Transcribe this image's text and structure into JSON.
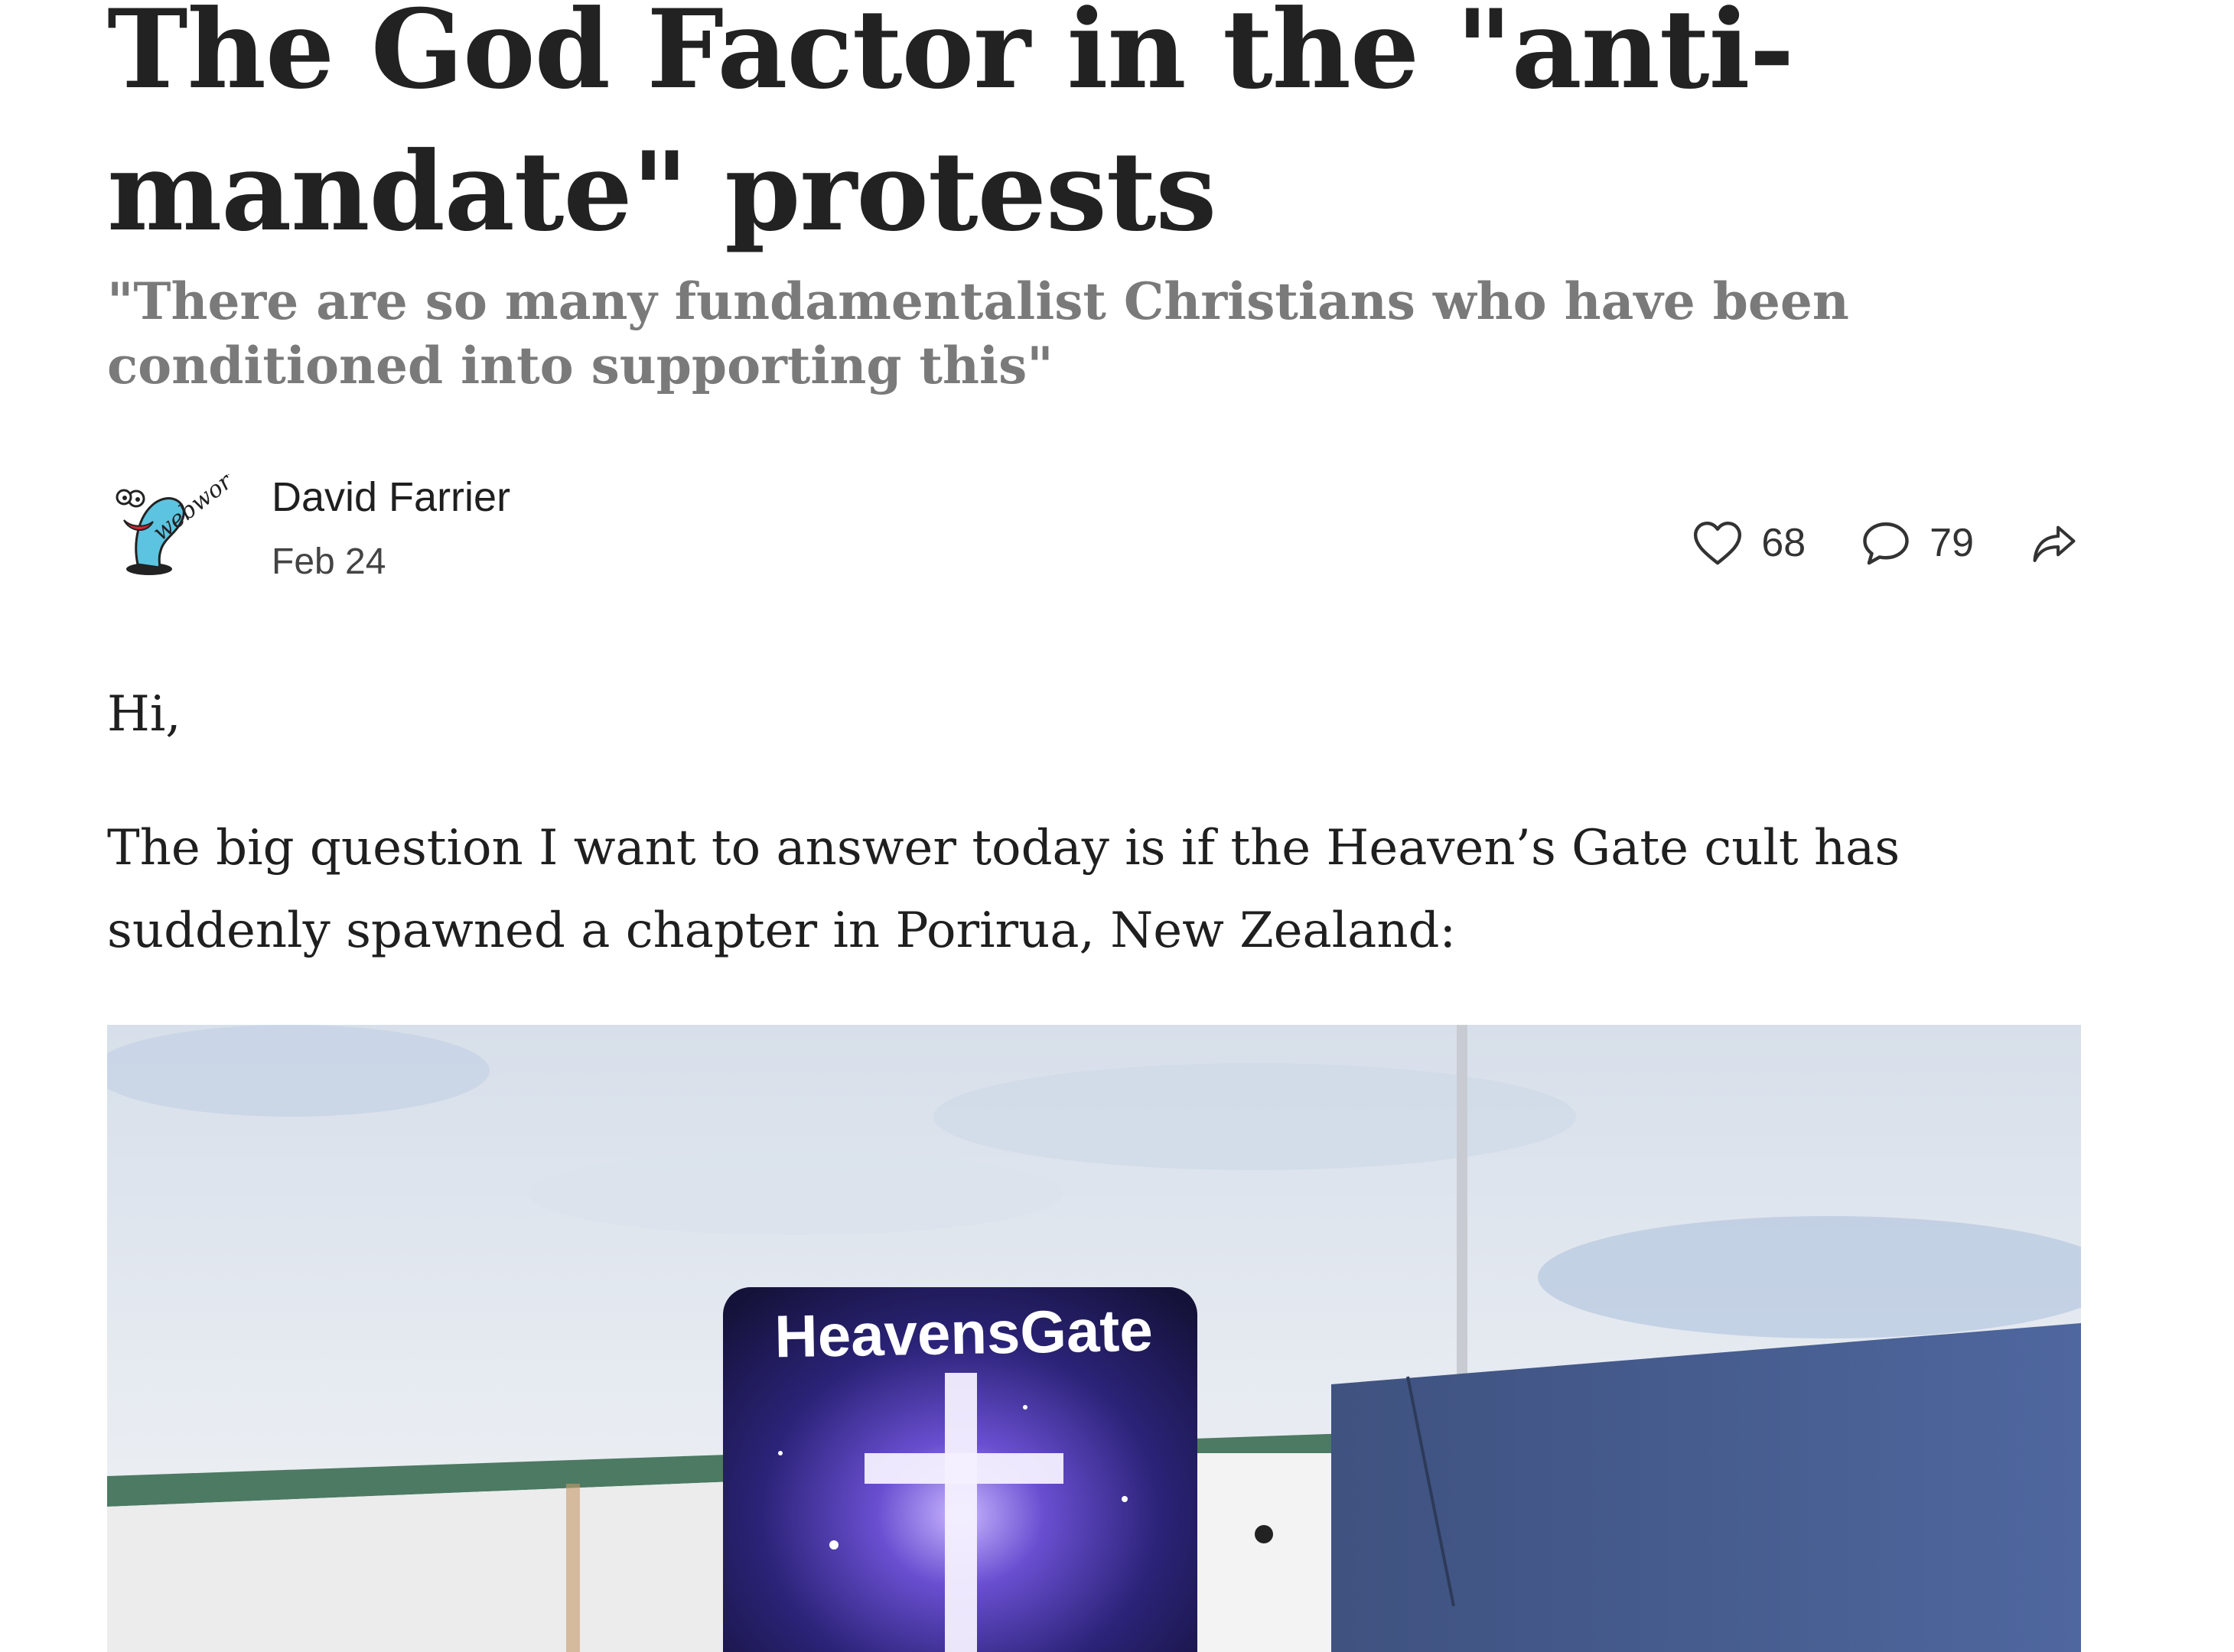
{
  "post": {
    "title": "The God Factor in the \"anti-mandate\" protests",
    "subtitle": "\"There are so many fundamentalist Christians who have been conditioned into supporting this\"",
    "author": {
      "name": "David Farrier",
      "avatar_icon": "webworm-logo-icon",
      "avatar_text": "webworm"
    },
    "date": "Feb 24",
    "actions": {
      "likes": "68",
      "comments": "79",
      "like_icon": "heart-icon",
      "comment_icon": "speech-bubble-icon",
      "share_icon": "share-arrow-icon"
    },
    "body": {
      "greeting": "Hi,",
      "intro": "The big question I want to answer today is if the Heaven’s Gate cult has suddenly spawned a chapter in Porirua, New Zealand:"
    },
    "image": {
      "sign_text": "HeavensGate"
    }
  },
  "colors": {
    "title": "#222222",
    "subtitle": "#7a7a7a",
    "body": "#1f1f1f",
    "sky": "#dfe6ef",
    "wall": "#eaeaea",
    "panel": "#4a5f8f",
    "sign": "#2a2a6e"
  }
}
